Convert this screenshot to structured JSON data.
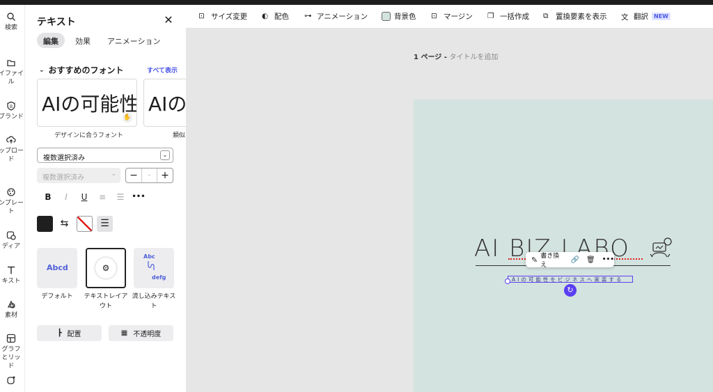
{
  "rail": {
    "items": [
      {
        "label": "検索",
        "icon": "search-icon"
      },
      {
        "label": "イファイル",
        "icon": "folder-icon"
      },
      {
        "label": "ブランド",
        "icon": "brand-icon"
      },
      {
        "label": "ップロード",
        "icon": "upload-icon"
      },
      {
        "label": "ンプレート",
        "icon": "template-icon"
      },
      {
        "label": "ディア",
        "icon": "media-icon"
      },
      {
        "label": "キスト",
        "icon": "text-icon"
      },
      {
        "label": "素材",
        "icon": "elements-icon"
      },
      {
        "label": "グラフとリッド",
        "icon": "grid-icon"
      }
    ]
  },
  "panel": {
    "title": "テキスト",
    "tabs": [
      "編集",
      "効果",
      "アニメーション"
    ],
    "recommended_fonts_label": "おすすめのフォント",
    "see_all": "すべて表示",
    "font_cards": [
      {
        "sample": "AIの可能性を",
        "caption": "デザインに合うフォント"
      },
      {
        "sample": "AIの可",
        "caption": "類似"
      }
    ],
    "font_select_value": "複数選択済み",
    "size_select_value": "複数選択済み",
    "size_value": "-",
    "format_buttons": [
      "B",
      "I",
      "U",
      "≡",
      "☰",
      "•••"
    ],
    "text_styles": [
      {
        "thumb": "Abcd",
        "label": "デフォルト"
      },
      {
        "label": "テキストレイアウト"
      },
      {
        "thumb": "Abc",
        "thumb2": "defg",
        "label": "流し込みテキスト"
      }
    ],
    "position_label": "配置",
    "opacity_label": "不透明度"
  },
  "toolbar": {
    "items": [
      {
        "label": "サイズ変更",
        "icon": "resize-icon"
      },
      {
        "label": "配色",
        "icon": "palette-icon"
      },
      {
        "label": "アニメーション",
        "icon": "animation-icon"
      },
      {
        "label": "背景色",
        "icon": "background-color-icon"
      },
      {
        "label": "マージン",
        "icon": "margin-icon"
      },
      {
        "label": "一括作成",
        "icon": "bulk-create-icon"
      },
      {
        "label": "置換要素を表示",
        "icon": "replace-icon"
      },
      {
        "label": "翻訳",
        "icon": "translate-icon"
      }
    ],
    "new_badge": "NEW"
  },
  "page": {
    "label": "1 ページ - ",
    "add_title": "タイトルを追加"
  },
  "canvas": {
    "logo": "AI BIZ LABO",
    "tagline": "AIの可能性をビジネスへ実装する",
    "context_menu_rewrite": "書き換え",
    "colors": {
      "background": "#d3e3df",
      "selection": "#5b3ff2",
      "accent_red": "#e11d1d"
    }
  }
}
